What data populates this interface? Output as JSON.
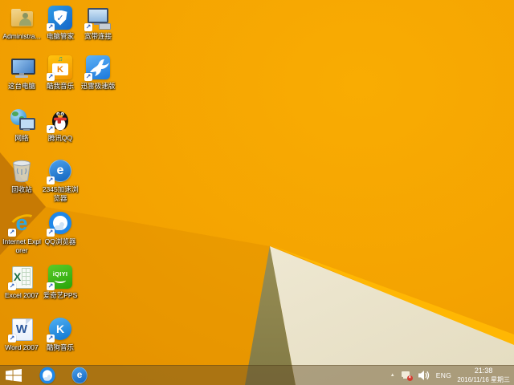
{
  "colors": {
    "wallpaper_bright": "#F9AC02",
    "wallpaper_base": "#F4A301",
    "wallpaper_deep": "#EC9801",
    "wallpaper_fold_dark": "#C77A04",
    "wallpaper_shade": "rgba(200,120,0,0.22)",
    "wallpaper_ridge": "#FFB703",
    "wallpaper_olive_top": "#B3A668",
    "wallpaper_olive_bottom": "#827A45",
    "wallpaper_cream_top": "#FCF9EE",
    "wallpaper_cream_bottom": "#E4DCC0",
    "taskbar_tint": "rgba(100,78,40,0.46)",
    "shortcut_arrow_blue": "#2458B8",
    "tray_badge_red": "#D43A2E"
  },
  "icon_colors": {
    "pc_manager": [
      "#2E9BE6",
      "#1365C8"
    ],
    "kuwo": [
      "#FFC30D",
      "#F29400"
    ],
    "kuwo_k": "#F08200",
    "kuwo_note": "#1A9E8F",
    "xunlei": [
      "#5EB2F6",
      "#1B78DC"
    ],
    "e2345": [
      "#4AA0EC",
      "#1365BE"
    ],
    "ie_blue": "#2EA7E0",
    "ie_swoosh": "#F2B200",
    "qqbrowser_ring": "#1F87E8",
    "excel_green": "#1E7145",
    "iqiyi": [
      "#5BCB28",
      "#27A40B"
    ],
    "word_blue": "#2B579A",
    "kugou": [
      "#52B1F2",
      "#0E76D2"
    ],
    "penguin_scarf": "#E53935",
    "penguin_beak": "#F5A623",
    "monitor_frame": "#2B3B52",
    "monitor_screen": [
      "#9AC8F2",
      "#417CC2"
    ],
    "folder": [
      "#F2D489",
      "#DCAC42"
    ]
  },
  "icon_glyphs": {
    "pc_manager_check": "✓",
    "kuwo_k": "K",
    "kuwo_notes": "♫",
    "e2345": "e",
    "ie_e": "e",
    "excel_x": "X",
    "word_w": "W",
    "kugou_k": "K",
    "iqiyi_text": "iQIYI",
    "shortcut_arrow": "↗"
  },
  "desktop": {
    "icons": [
      {
        "id": "administrator-folder",
        "label": "Administra...",
        "kind": "folderuser",
        "col": 1,
        "row": 1,
        "shortcut": false
      },
      {
        "id": "pc-manager",
        "label": "电脑管家",
        "kind": "shield",
        "col": 2,
        "row": 1,
        "shortcut": true
      },
      {
        "id": "broadband-connection",
        "label": "宽带连接",
        "kind": "broadband",
        "col": 3,
        "row": 1,
        "shortcut": true
      },
      {
        "id": "this-pc",
        "label": "这台电脑",
        "kind": "computer",
        "col": 1,
        "row": 2,
        "shortcut": false
      },
      {
        "id": "kuwo-music",
        "label": "酷我音乐",
        "kind": "kuwo",
        "col": 2,
        "row": 2,
        "shortcut": true
      },
      {
        "id": "xunlei-thunder",
        "label": "迅雷极速版",
        "kind": "bird",
        "col": 3,
        "row": 2,
        "shortcut": true
      },
      {
        "id": "network",
        "label": "网络",
        "kind": "globe",
        "col": 1,
        "row": 3,
        "shortcut": false
      },
      {
        "id": "tencent-qq",
        "label": "腾讯QQ",
        "kind": "penguin",
        "col": 2,
        "row": 3,
        "shortcut": true
      },
      {
        "id": "recycle-bin",
        "label": "回收站",
        "kind": "recycle",
        "col": 1,
        "row": 4,
        "shortcut": false
      },
      {
        "id": "browser-2345",
        "label": "2345加速浏览器",
        "kind": "e2345",
        "col": 2,
        "row": 4,
        "shortcut": true
      },
      {
        "id": "internet-explorer",
        "label": "Internet Explorer",
        "kind": "ie",
        "col": 1,
        "row": 5,
        "shortcut": true
      },
      {
        "id": "qq-browser",
        "label": "QQ浏览器",
        "kind": "qqbrowser",
        "col": 2,
        "row": 5,
        "shortcut": true
      },
      {
        "id": "excel-2007",
        "label": "Excel 2007",
        "kind": "excel",
        "col": 1,
        "row": 6,
        "shortcut": true
      },
      {
        "id": "iqiyi-pps",
        "label": "爱奇艺PPS",
        "kind": "iqiyi",
        "col": 2,
        "row": 6,
        "shortcut": true
      },
      {
        "id": "word-2007",
        "label": "Word 2007",
        "kind": "word",
        "col": 1,
        "row": 7,
        "shortcut": true
      },
      {
        "id": "kugou-music",
        "label": "酷狗音乐",
        "kind": "kugou",
        "col": 2,
        "row": 7,
        "shortcut": true
      }
    ]
  },
  "taskbar": {
    "apps": [
      {
        "id": "taskbar-qq-browser",
        "kind": "qqbrowser"
      },
      {
        "id": "taskbar-2345-browser",
        "kind": "e2345"
      }
    ],
    "tray": {
      "overflow_arrow": "▲",
      "network_error_mark": "×",
      "lang": "ENG",
      "time": "21:38",
      "date": "2016/11/16 星期三"
    }
  }
}
